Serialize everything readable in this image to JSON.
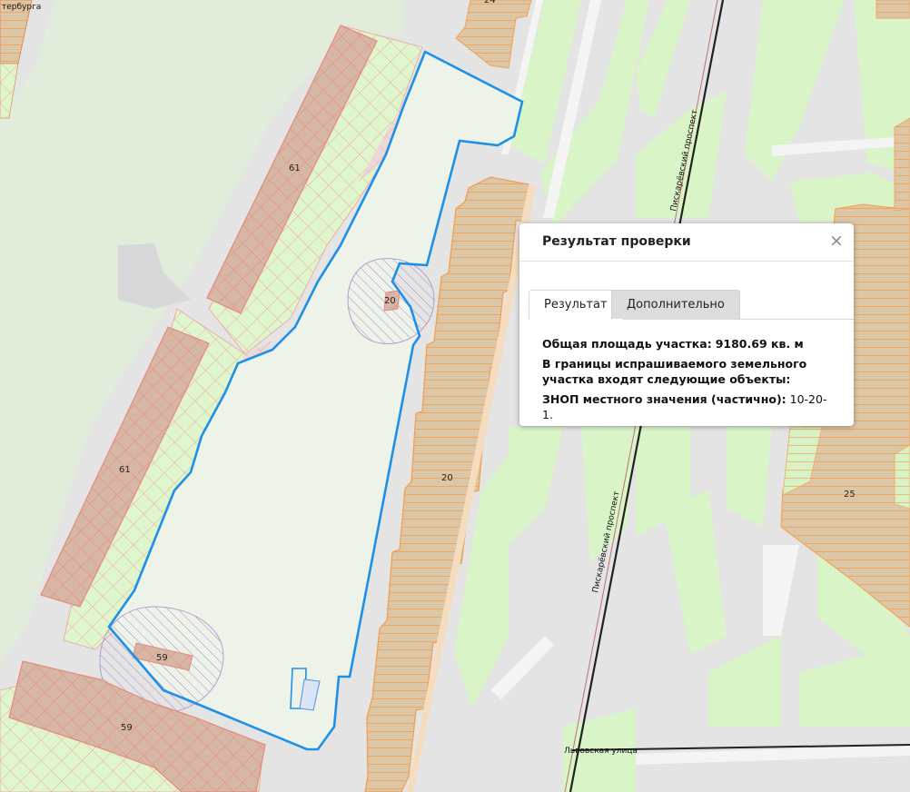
{
  "map": {
    "street_labels": {
      "top_left_fragment": "тербурга",
      "piskarevsky_upper": "Пискарёвский проспект",
      "piskarevsky_lower": "Пискарёвский проспект",
      "lvovskaya": "Львовская улица"
    },
    "parcel_labels": {
      "b61_upper": "61",
      "b61_lower": "61",
      "b20_small": "20",
      "b20_long": "20",
      "b59_small": "59",
      "b59_lower": "59",
      "b25": "25",
      "b24": "24"
    },
    "colors": {
      "selected_outline": "#1e90e6",
      "parcel_fill": "#d9c4a6",
      "parcel_orange": "#f0a860",
      "parcel_red": "#e88880",
      "green_zone": "#d9f5c8",
      "large_green": "#e2ecdb",
      "hatch_purple": "#a07cc0"
    }
  },
  "popup": {
    "title": "Результат проверки",
    "close_symbol": "×",
    "tabs": [
      {
        "label": "Результат"
      },
      {
        "label": "Дополнительно"
      }
    ],
    "area_label": "Общая площадь участка:",
    "area_value": "9180.69 кв. м",
    "objects_intro": "В границы испрашиваемого земельного участка входят следующие объекты:",
    "znop_label": "ЗНОП местного значения (частично):",
    "znop_value": "10-20-1."
  }
}
